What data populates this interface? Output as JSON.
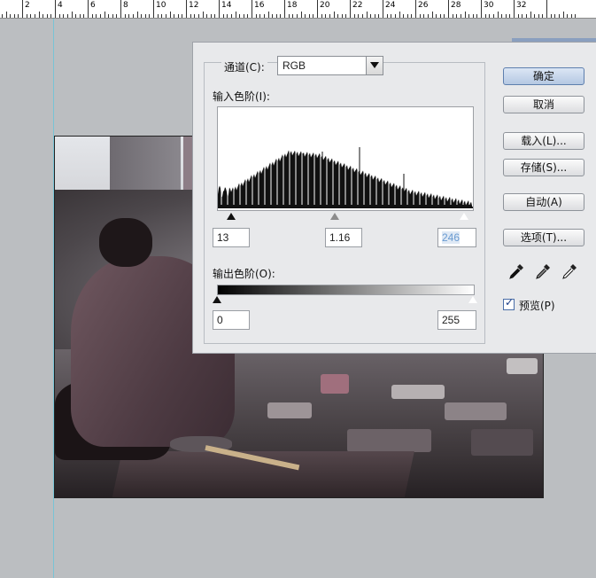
{
  "ruler": {
    "labels": [
      "2",
      "4",
      "6",
      "8",
      "10",
      "12",
      "14",
      "16",
      "18",
      "20",
      "22",
      "24",
      "26",
      "28",
      "30",
      "32"
    ]
  },
  "dialog": {
    "channel_label": "通道(C):",
    "channel_value": "RGB",
    "input_levels_label": "输入色阶(I):",
    "output_levels_label": "输出色阶(O):",
    "input_black": "13",
    "input_gamma": "1.16",
    "input_white": "246",
    "output_black": "0",
    "output_white": "255",
    "buttons": {
      "ok": "确定",
      "cancel": "取消",
      "load": "载入(L)...",
      "save": "存储(S)...",
      "auto": "自动(A)",
      "options": "选项(T)..."
    },
    "preview_label": "预览(P)",
    "preview_checked": true,
    "eyedroppers": [
      "black-eyedropper-icon",
      "gray-eyedropper-icon",
      "white-eyedropper-icon"
    ]
  },
  "colors": {
    "canvas_bg": "#bbbec1",
    "dialog_bg": "#e8e9eb",
    "default_button": "#b5c8e2",
    "guide": "#79c4d6"
  }
}
